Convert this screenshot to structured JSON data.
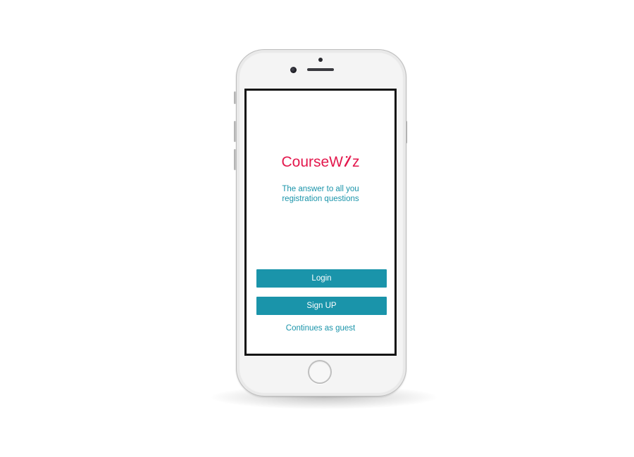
{
  "app": {
    "logo_prefix": "CourseW",
    "logo_suffix": "z",
    "brand_color": "#e3174c",
    "accent_color": "#1a94aa"
  },
  "tagline": {
    "line1": "The answer to all you",
    "line2": "registration questions"
  },
  "actions": {
    "login_label": "Login",
    "signup_label": "Sign UP",
    "guest_label": "Continues as guest"
  },
  "device": {
    "model": "phone-white-silver",
    "icons": [
      "camera-icon",
      "speaker-icon",
      "home-button"
    ]
  }
}
